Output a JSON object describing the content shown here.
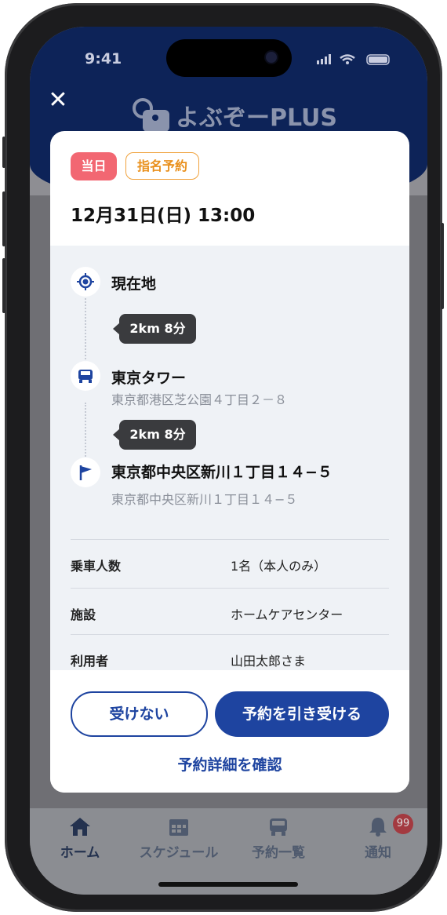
{
  "status_bar": {
    "time": "9:41"
  },
  "header": {
    "close_icon": "close-icon",
    "logo_text": "よぶぞーPLUS"
  },
  "card": {
    "tags": {
      "today": "当日",
      "named": "指名予約"
    },
    "datetime": "12月31日(日) 13:00",
    "route": {
      "start": {
        "title": "現在地",
        "icon": "location-target-icon"
      },
      "leg1": "2km 8分",
      "pickup": {
        "title": "東京タワー",
        "address": "東京都港区芝公園４丁目２－８",
        "icon": "car-icon"
      },
      "leg2": "2km 8分",
      "destination": {
        "title": "東京都中央区新川１丁目１４−５",
        "address": "東京都中央区新川１丁目１４−５",
        "icon": "flag-icon"
      }
    },
    "info": [
      {
        "label": "乗車人数",
        "value": "1名（本人のみ）"
      },
      {
        "label": "施設",
        "value": "ホームケアセンター"
      },
      {
        "label": "利用者",
        "value": "山田太郎さま"
      }
    ],
    "actions": {
      "decline": "受けない",
      "accept": "予約を引き受ける",
      "detail": "予約詳細を確認"
    }
  },
  "tabbar": {
    "items": [
      {
        "label": "ホーム",
        "icon": "home-icon",
        "active": true
      },
      {
        "label": "スケジュール",
        "icon": "calendar-icon",
        "active": false
      },
      {
        "label": "予約一覧",
        "icon": "car-icon",
        "active": false
      },
      {
        "label": "通知",
        "icon": "bell-icon",
        "active": false
      }
    ],
    "notification_badge": "99"
  },
  "colors": {
    "primary": "#1e44a0",
    "header": "#0d2358",
    "today_tag": "#f26772",
    "named_tag": "#e9901c"
  }
}
